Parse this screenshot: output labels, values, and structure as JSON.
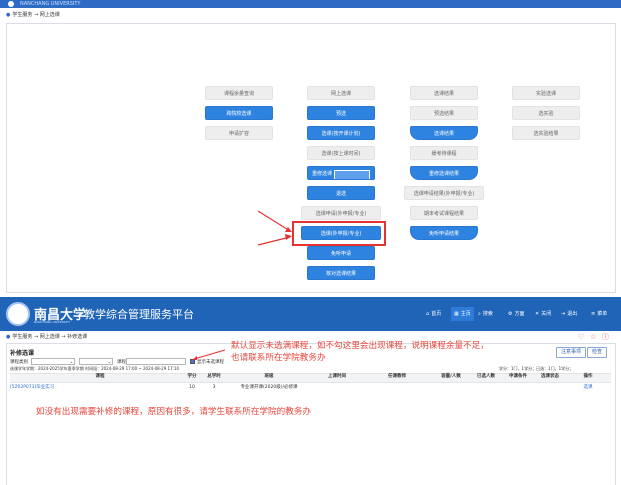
{
  "top": {
    "brand_text": "NANCHANG UNIVERSITY",
    "breadcrumb": "学生服务 → 网上选课",
    "buttons": {
      "col1": [
        "课程余量查询",
        "跨院校选课",
        "申请扩容"
      ],
      "col2": [
        "网上选课",
        "预选",
        "选课(按开课计划)",
        "选课(按上课时间)",
        "重修选课",
        "退选",
        "选课申请(外申报/专业)",
        "选课(外申报/专业)",
        "免听申请",
        "核对选课结果"
      ],
      "col3": [
        "选课结果",
        "预选结果",
        "选课结果",
        "缓考待课程",
        "重修选课结果",
        "选课申请结果(外申报/专业)",
        "期末考试课程结果",
        "免听申请结果"
      ],
      "col4": [
        "实验选课",
        "选实验",
        "选实验结果"
      ]
    }
  },
  "bottom": {
    "university_name": "南昌大学",
    "university_sub": "NANCHANG UNIVERSITY",
    "platform_title": "教学综合管理服务平台",
    "nav": [
      {
        "icon": "home-icon",
        "label": "首页"
      },
      {
        "icon": "grid-icon",
        "label": "主页"
      },
      {
        "icon": "search-icon",
        "label": "搜索"
      },
      {
        "icon": "settings-icon",
        "label": "方面"
      },
      {
        "icon": "close-icon",
        "label": "关闭"
      },
      {
        "icon": "logout-icon",
        "label": "退出"
      },
      {
        "icon": "menu-icon",
        "label": "菜单"
      }
    ],
    "breadcrumb": "学生服务 → 网上选课 → 补修选课",
    "panel_title": "补修选课",
    "buttons": [
      "注意事项",
      "检查"
    ],
    "filters": {
      "type_label": "课程类别",
      "course_label": "课程",
      "checkbox_label": "显示未选课程"
    },
    "period_text": "选课学年学期：2024-2025学年夏季学期  时间段：2024-08-29 17:00 ~ 2024-08-29 17:10",
    "credit_summary": "学分：1门，1学分；已选：1门，1学分；",
    "table": {
      "headers": [
        "课程",
        "学分",
        "总学时",
        "班级",
        "上课时间",
        "任课教师",
        "容量/人数",
        "已选人数",
        "申请条件",
        "选课状态",
        "操作"
      ],
      "rows": [
        [
          "[5202P073]毕业实习",
          "10",
          "3",
          "专业课开课(2020级)/必修课",
          "",
          "",
          "",
          "",
          "",
          "",
          "选课"
        ]
      ]
    },
    "annotations": {
      "note1_line1": "默认显示未选满课程，如不勾这里会出现课程，说明课程余量不足，",
      "note1_line2": "也请联系所在学院教务办",
      "note2": "如没有出现需要补修的课程，原因有很多，请学生联系所在学院的教务办"
    }
  },
  "colors": {
    "brand_blue": "#1f64b7",
    "button_blue": "#2e82e0",
    "annotation_red": "#e8463c"
  }
}
